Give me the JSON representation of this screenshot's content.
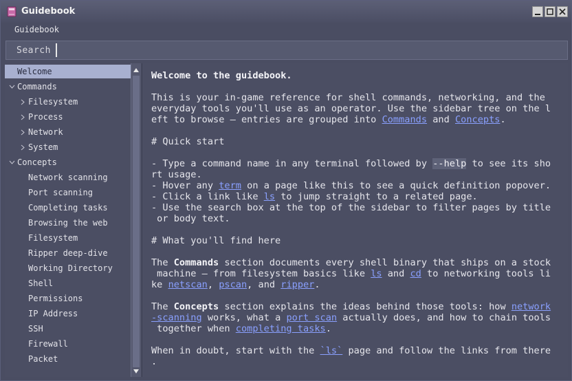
{
  "window": {
    "title": "Guidebook"
  },
  "menubar": {
    "menu_label": "Guidebook"
  },
  "search": {
    "label": "Search",
    "value": ""
  },
  "sidebar": {
    "items": [
      {
        "label": "Welcome",
        "selected": true
      },
      {
        "label": "Commands",
        "expanded": true
      },
      {
        "label": "Filesystem"
      },
      {
        "label": "Process"
      },
      {
        "label": "Network"
      },
      {
        "label": "System"
      },
      {
        "label": "Concepts",
        "expanded": true
      },
      {
        "label": "Network scanning"
      },
      {
        "label": "Port scanning"
      },
      {
        "label": "Completing tasks"
      },
      {
        "label": "Browsing the web"
      },
      {
        "label": "Filesystem"
      },
      {
        "label": "Ripper deep-dive"
      },
      {
        "label": "Working Directory"
      },
      {
        "label": "Shell"
      },
      {
        "label": "Permissions"
      },
      {
        "label": "IP Address"
      },
      {
        "label": "SSH"
      },
      {
        "label": "Firewall"
      },
      {
        "label": "Packet"
      }
    ]
  },
  "content": {
    "heading": "Welcome to the guidebook.",
    "intro": {
      "l1": "This is your in-game reference for shell commands, networking, and the",
      "l2": "everyday tools you'll use as an operator. Use the sidebar tree on the l",
      "l3a": "eft to browse — entries are grouped into ",
      "l3_link1": "Commands",
      "l3b": " and ",
      "l3_link2": "Concepts",
      "l3c": "."
    },
    "quick_start_heading": "# Quick start",
    "qs": {
      "a1": "- Type a command name in any terminal followed by ",
      "a_code": "--help",
      "a2": " to see its sho",
      "a3": "rt usage.",
      "b1": "- Hover any ",
      "b_link": "term",
      "b2": " on a page like this to see a quick definition popover.",
      "c1": "- Click a link like ",
      "c_link": "ls",
      "c2": " to jump straight to a related page.",
      "d1": "- Use the search box at the top of the sidebar to filter pages by title",
      "d2": " or body text."
    },
    "find_heading": "# What you'll find here",
    "commands_para": {
      "p1a": "The ",
      "p1_bold": "Commands",
      "p1b": " section documents every shell binary that ships on a stock",
      "p2a": " machine — from filesystem basics like ",
      "p2_link1": "ls",
      "p2b": " and ",
      "p2_link2": "cd",
      "p2c": " to networking tools li",
      "p3a": "ke ",
      "p3_link1": "netscan",
      "p3b": ", ",
      "p3_link2": "pscan",
      "p3c": ", and ",
      "p3_link3": "ripper",
      "p3d": "."
    },
    "concepts_para": {
      "p1a": "The ",
      "p1_bold": "Concepts",
      "p1b": " section explains the ideas behind those tools: how ",
      "p1_link": "network",
      "p2_link": "-scanning",
      "p2a": " works, what a ",
      "p2_link2": "port scan",
      "p2b": " actually does, and how to chain tools",
      "p3a": " together when ",
      "p3_link": "completing tasks",
      "p3b": "."
    },
    "closing": {
      "p1a": "When in doubt, start with the ",
      "p1_link": "`ls`",
      "p1b": " page and follow the links from there",
      "p2": "."
    }
  },
  "colors": {
    "link": "#8aa0ff",
    "selected_bg": "#a8b0d0",
    "panel_bg": "#4b4e63"
  }
}
